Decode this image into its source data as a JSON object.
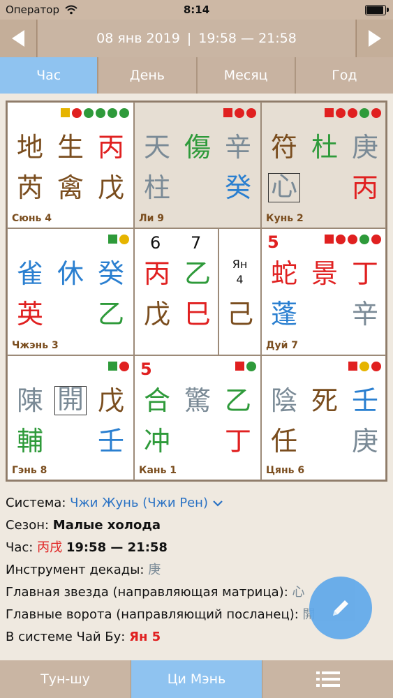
{
  "status": {
    "carrier": "Оператор",
    "time": "8:14"
  },
  "header": {
    "date": "08 янв 2019",
    "separator": "|",
    "time_range": "19:58 — 21:58"
  },
  "tabs": [
    {
      "label": "Час"
    },
    {
      "label": "День"
    },
    {
      "label": "Месяц"
    },
    {
      "label": "Год"
    }
  ],
  "colors": {
    "brown": "#7a4d1e",
    "green": "#2e9a3a",
    "red": "#e02020",
    "blue": "#2a7fd0",
    "gray": "#7a8a96",
    "yellow": "#e6b400",
    "black": "#111111"
  },
  "grid": {
    "c1": {
      "label": "Сюнь 4",
      "c": [
        {
          "t": "地",
          "col": "#7a4d1e"
        },
        {
          "t": "生",
          "col": "#7a4d1e"
        },
        {
          "t": "丙",
          "col": "#e02020"
        },
        {
          "t": "芮",
          "col": "#7a4d1e"
        },
        {
          "t": "禽",
          "col": "#7a4d1e"
        },
        {
          "t": "戊",
          "col": "#7a4d1e"
        }
      ]
    },
    "c2": {
      "label": "Ли 9",
      "c": [
        {
          "t": "天",
          "col": "#7a8a96"
        },
        {
          "t": "傷",
          "col": "#2e9a3a"
        },
        {
          "t": "辛",
          "col": "#7a8a96"
        },
        {
          "t": "柱",
          "col": "#7a8a96"
        },
        {
          "t": "癸",
          "col": "#2a7fd0"
        }
      ]
    },
    "c3": {
      "label": "Кунь 2",
      "c": [
        {
          "t": "符",
          "col": "#7a4d1e"
        },
        {
          "t": "杜",
          "col": "#2e9a3a"
        },
        {
          "t": "庚",
          "col": "#7a8a96"
        },
        {
          "t": "心",
          "col": "#7a8a96"
        },
        {
          "t": "丙",
          "col": "#e02020"
        }
      ]
    },
    "c4": {
      "label": "Чжэнь 3",
      "c": [
        {
          "t": "雀",
          "col": "#2a7fd0"
        },
        {
          "t": "休",
          "col": "#2a7fd0"
        },
        {
          "t": "癸",
          "col": "#2a7fd0"
        },
        {
          "t": "英",
          "col": "#e02020"
        },
        {
          "t": "乙",
          "col": "#2e9a3a"
        }
      ]
    },
    "c5": {
      "n1": "6",
      "n2": "7",
      "c": [
        {
          "t": "丙",
          "col": "#e02020"
        },
        {
          "t": "乙",
          "col": "#2e9a3a"
        },
        {
          "t": "戊",
          "col": "#7a4d1e"
        },
        {
          "t": "巳",
          "col": "#e02020"
        }
      ]
    },
    "c5b": {
      "l1": "Ян",
      "l2": "4",
      "c": [
        {
          "t": "己",
          "col": "#7a4d1e"
        }
      ]
    },
    "c6": {
      "label": "Дуй 7",
      "n": "5",
      "c": [
        {
          "t": "蛇",
          "col": "#e02020"
        },
        {
          "t": "景",
          "col": "#e02020"
        },
        {
          "t": "丁",
          "col": "#e02020"
        },
        {
          "t": "蓬",
          "col": "#2a7fd0"
        },
        {
          "t": "辛",
          "col": "#7a8a96"
        }
      ]
    },
    "c7": {
      "label": "Гэнь 8",
      "c": [
        {
          "t": "陳",
          "col": "#7a8a96"
        },
        {
          "t": "開",
          "col": "#7a8a96"
        },
        {
          "t": "戊",
          "col": "#7a4d1e"
        },
        {
          "t": "輔",
          "col": "#2e9a3a"
        },
        {
          "t": "壬",
          "col": "#2a7fd0"
        }
      ]
    },
    "c8": {
      "label": "Кань 1",
      "n": "5",
      "c": [
        {
          "t": "合",
          "col": "#2e9a3a"
        },
        {
          "t": "驚",
          "col": "#7a8a96"
        },
        {
          "t": "乙",
          "col": "#2e9a3a"
        },
        {
          "t": "冲",
          "col": "#2e9a3a"
        },
        {
          "t": "丁",
          "col": "#e02020"
        }
      ]
    },
    "c9": {
      "label": "Цянь 6",
      "c": [
        {
          "t": "陰",
          "col": "#7a8a96"
        },
        {
          "t": "死",
          "col": "#7a4d1e"
        },
        {
          "t": "壬",
          "col": "#2a7fd0"
        },
        {
          "t": "任",
          "col": "#7a4d1e"
        },
        {
          "t": "庚",
          "col": "#7a8a96"
        }
      ]
    }
  },
  "info": {
    "system_label": "Система:",
    "system_value": "Чжи Жунь (Чжи Рен)",
    "season_label": "Сезон:",
    "season_value": "Малые холода",
    "hour_label": "Час:",
    "hour_chars": "丙戌",
    "hour_range": "19:58 — 21:58",
    "decade_label": "Инструмент декады:",
    "decade_value": "庚",
    "star_label": "Главная звезда (направляющая матрица):",
    "star_value": "心",
    "gate_label": "Главные ворота (направляющий посланец):",
    "gate_value": "開",
    "chaibu_label": "В системе Чай Бу:",
    "chaibu_value": "Ян 5"
  },
  "bottom": {
    "tun_shu": "Тун-шу",
    "qi_men": "Ци Мэнь"
  }
}
